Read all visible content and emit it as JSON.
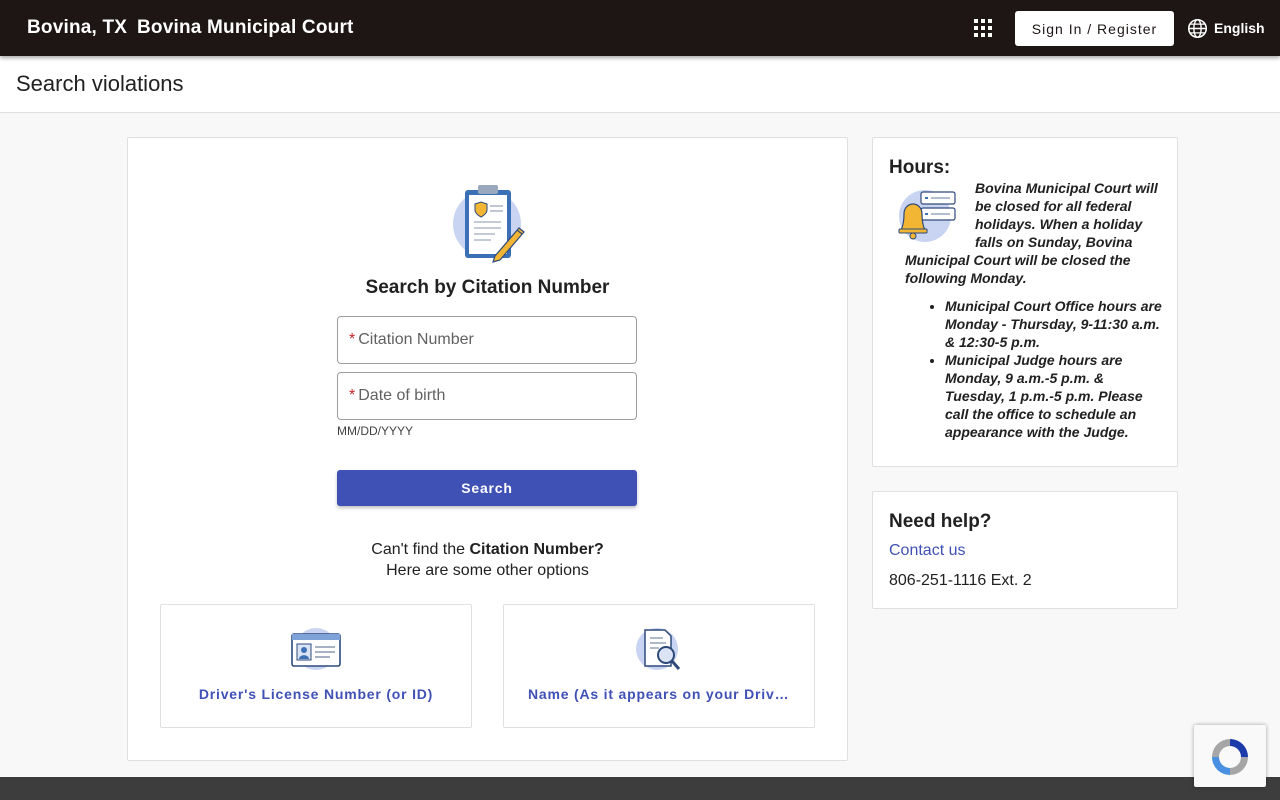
{
  "header": {
    "city": "Bovina, TX",
    "court": "Bovina Municipal Court",
    "signin_label": "Sign In / Register",
    "language_label": "English"
  },
  "page": {
    "title": "Search violations"
  },
  "search": {
    "heading": "Search by Citation Number",
    "citation_placeholder": "Citation Number",
    "dob_placeholder": "Date of birth",
    "required_mark": "*",
    "dob_hint": "MM/DD/YYYY",
    "button_label": "Search",
    "cant_find_prefix": "Can't find the ",
    "cant_find_bold": "Citation Number?",
    "cant_find_line2": "Here are some other options"
  },
  "options": [
    {
      "label": "Driver's License Number (or ID)",
      "icon": "id-card-icon"
    },
    {
      "label": "Name (As it appears on your Driver's License)",
      "icon": "document-search-icon"
    }
  ],
  "hours": {
    "heading": "Hours:",
    "intro": "Bovina Municipal Court will be closed for all federal holidays. When a holiday falls on Sunday, Bovina Municipal Court will be closed the following Monday.",
    "items": [
      "Municipal Court Office hours are Monday - Thursday, 9-11:30 a.m. & 12:30-5 p.m.",
      "Municipal Judge hours are Monday, 9 a.m.-5 p.m. & Tuesday, 1 p.m.-5 p.m. Please call the office to schedule an appearance with the Judge."
    ]
  },
  "help": {
    "heading": "Need help?",
    "contact_label": "Contact us",
    "phone": "806-251-1116 Ext. 2"
  },
  "colors": {
    "header_bg": "#1e1515",
    "primary": "#3f51b5",
    "required": "#c62828",
    "footer_bg": "#3d3d3d"
  }
}
